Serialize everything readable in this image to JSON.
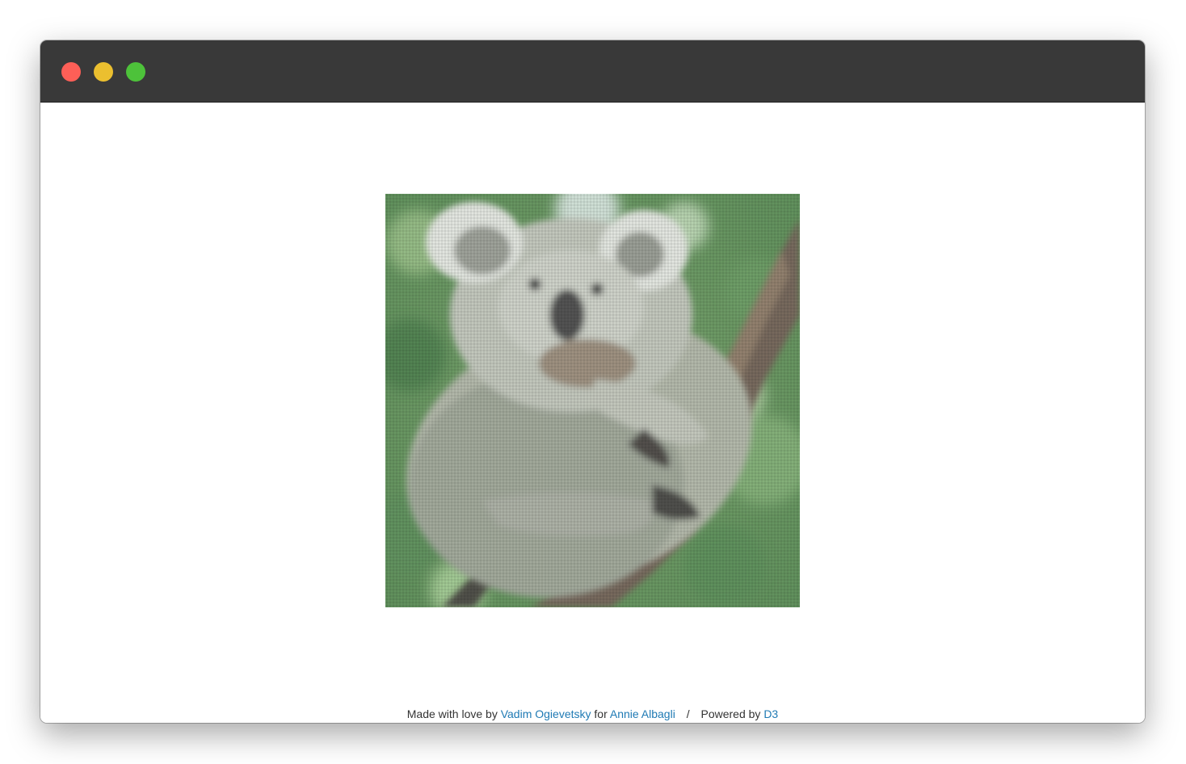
{
  "window": {
    "controls": [
      {
        "name": "close",
        "color": "#fe5f57"
      },
      {
        "name": "minimize",
        "color": "#ebbf2f"
      },
      {
        "name": "maximize",
        "color": "#4dc23a"
      }
    ]
  },
  "colors": {
    "link": "#1f7ab4",
    "text": "#333333",
    "titlebar": "#393939"
  },
  "footer": {
    "made_with": "Made with love by",
    "author": "Vadim Ogievetsky",
    "for_text": "for",
    "recipient": "Annie Albagli",
    "separator": "/",
    "powered_by": "Powered by",
    "library": "D3"
  }
}
